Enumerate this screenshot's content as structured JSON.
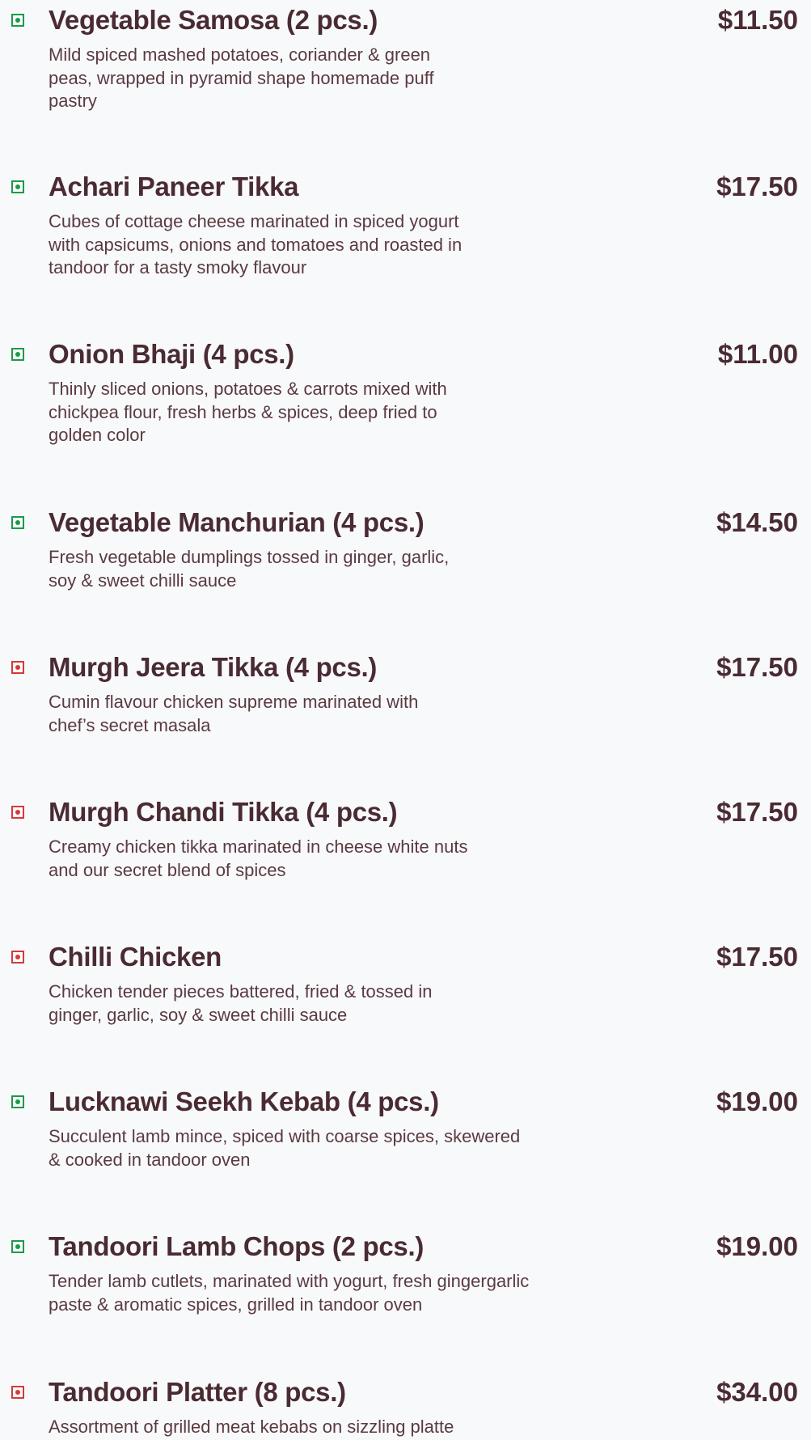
{
  "menu": {
    "items": [
      {
        "name": "Vegetable Samosa  (2 pcs.)",
        "price": "$11.50",
        "diet": "veg",
        "description": "Mild spiced mashed potatoes, coriander & green\npeas, wrapped in pyramid shape homemade puff\npastry"
      },
      {
        "name": "Achari Paneer Tikka",
        "price": "$17.50",
        "diet": "veg",
        "description": "Cubes of cottage cheese marinated in spiced yogurt\nwith capsicums, onions and tomatoes and roasted in\ntandoor for a tasty smoky flavour"
      },
      {
        "name": "Onion Bhaji  (4 pcs.)",
        "price": "$11.00",
        "diet": "veg",
        "description": "Thinly sliced onions, potatoes & carrots mixed with\nchickpea flour, fresh herbs & spices, deep fried to\ngolden color"
      },
      {
        "name": "Vegetable Manchurian (4 pcs.)",
        "price": "$14.50",
        "diet": "veg",
        "description": "Fresh vegetable dumplings tossed in ginger, garlic,\nsoy & sweet chilli sauce"
      },
      {
        "name": "Murgh Jeera Tikka  (4 pcs.)",
        "price": "$17.50",
        "diet": "nonveg",
        "description": "Cumin flavour chicken supreme marinated with\nchef’s secret masala"
      },
      {
        "name": "Murgh Chandi Tikka  (4 pcs.)",
        "price": "$17.50",
        "diet": "nonveg",
        "description": "Creamy chicken tikka marinated in cheese white nuts\nand our secret blend of spices"
      },
      {
        "name": "Chilli Chicken",
        "price": "$17.50",
        "diet": "nonveg",
        "description": "Chicken tender pieces battered, fried & tossed in\nginger, garlic, soy & sweet chilli sauce"
      },
      {
        "name": "Lucknawi Seekh Kebab  (4 pcs.)",
        "price": "$19.00",
        "diet": "veg",
        "description": "Succulent lamb mince, spiced with coarse spices, skewered\n& cooked in tandoor oven"
      },
      {
        "name": "Tandoori Lamb Chops (2 pcs.)",
        "price": "$19.00",
        "diet": "veg",
        "description": "Tender lamb cutlets, marinated with yogurt, fresh gingergarlic\npaste & aromatic spices, grilled in tandoor oven"
      },
      {
        "name": "Tandoori Platter (8 pcs.)",
        "price": "$34.00",
        "diet": "nonveg",
        "description": "Assortment of grilled meat kebabs on sizzling platte"
      }
    ]
  },
  "colors": {
    "text": "#4a2b33",
    "veg": "#1a9a4a",
    "nonveg": "#d43a3a",
    "background": "#f8f9fa"
  }
}
